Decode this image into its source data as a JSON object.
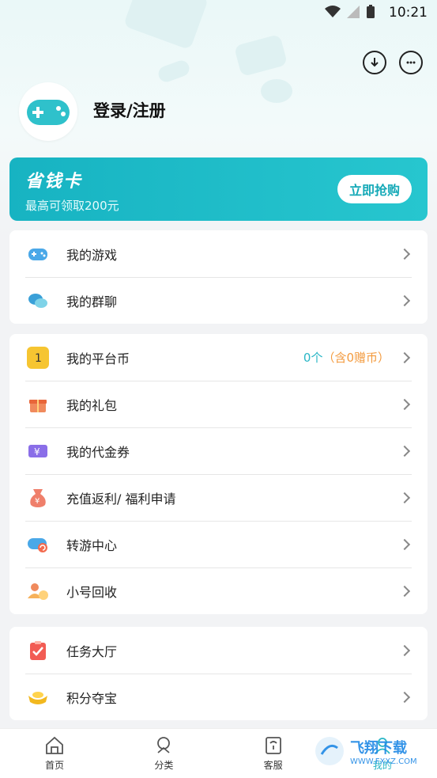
{
  "status_bar": {
    "time": "10:21"
  },
  "user": {
    "login_text": "登录/注册"
  },
  "banner": {
    "title": "省钱卡",
    "subtitle": "最高可领取200元",
    "button": "立即抢购"
  },
  "group1": [
    {
      "label": "我的游戏",
      "icon": "gamepad-icon"
    },
    {
      "label": "我的群聊",
      "icon": "chat-icon"
    }
  ],
  "group2": [
    {
      "label": "我的平台币",
      "icon": "coin-icon",
      "value_count": "0个",
      "value_note": "（含0赠币）"
    },
    {
      "label": "我的礼包",
      "icon": "gift-icon"
    },
    {
      "label": "我的代金券",
      "icon": "voucher-icon"
    },
    {
      "label": "充值返利/ 福利申请",
      "icon": "money-bag-icon"
    },
    {
      "label": "转游中心",
      "icon": "transfer-game-icon"
    },
    {
      "label": "小号回收",
      "icon": "account-recycle-icon"
    }
  ],
  "group3": [
    {
      "label": "任务大厅",
      "icon": "task-icon"
    },
    {
      "label": "积分夺宝",
      "icon": "gold-ingot-icon"
    }
  ],
  "tabs": [
    {
      "label": "首页",
      "icon": "home-icon"
    },
    {
      "label": "分类",
      "icon": "category-icon"
    },
    {
      "label": "客服",
      "icon": "service-icon"
    },
    {
      "label": "我的",
      "icon": "profile-icon"
    }
  ],
  "watermark": {
    "text": "飞翔下载",
    "sub": "WWW.FXXZ.COM"
  },
  "colors": {
    "accent": "#1fb9c6",
    "orange": "#f39a3d"
  }
}
